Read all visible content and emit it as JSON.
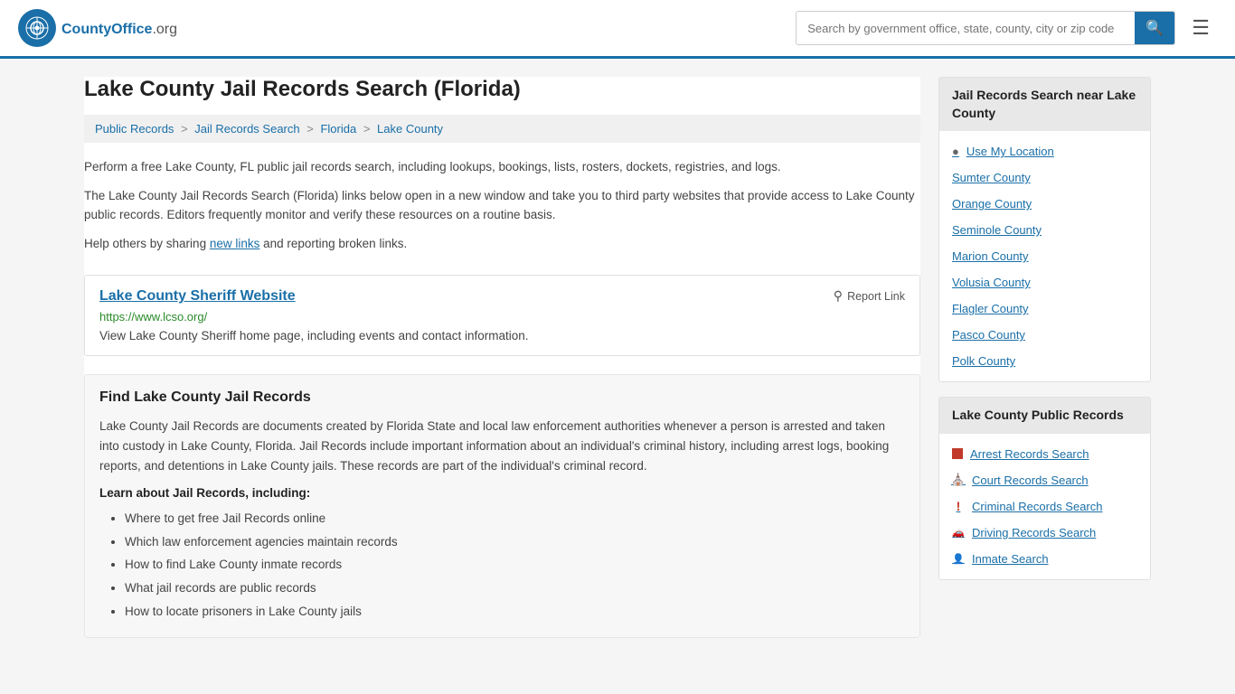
{
  "header": {
    "logo_text": "CountyOffice",
    "logo_suffix": ".org",
    "search_placeholder": "Search by government office, state, county, city or zip code"
  },
  "page": {
    "title": "Lake County Jail Records Search (Florida)",
    "breadcrumb": [
      {
        "label": "Public Records",
        "href": "#"
      },
      {
        "label": "Jail Records Search",
        "href": "#"
      },
      {
        "label": "Florida",
        "href": "#"
      },
      {
        "label": "Lake County",
        "href": "#"
      }
    ],
    "description1": "Perform a free Lake County, FL public jail records search, including lookups, bookings, lists, rosters, dockets, registries, and logs.",
    "description2": "The Lake County Jail Records Search (Florida) links below open in a new window and take you to third party websites that provide access to Lake County public records. Editors frequently monitor and verify these resources on a routine basis.",
    "description3_prefix": "Help others by sharing ",
    "description3_link": "new links",
    "description3_suffix": " and reporting broken links.",
    "link_card": {
      "title": "Lake County Sheriff Website",
      "report_label": "Report Link",
      "url": "https://www.lcso.org/",
      "description": "View Lake County Sheriff home page, including events and contact information."
    },
    "find_section": {
      "title": "Find Lake County Jail Records",
      "text": "Lake County Jail Records are documents created by Florida State and local law enforcement authorities whenever a person is arrested and taken into custody in Lake County, Florida. Jail Records include important information about an individual's criminal history, including arrest logs, booking reports, and detentions in Lake County jails. These records are part of the individual's criminal record.",
      "learn_title": "Learn about Jail Records, including:",
      "learn_items": [
        "Where to get free Jail Records online",
        "Which law enforcement agencies maintain records",
        "How to find Lake County inmate records",
        "What jail records are public records",
        "How to locate prisoners in Lake County jails"
      ]
    }
  },
  "sidebar": {
    "nearby_title": "Jail Records Search near Lake County",
    "use_location": "Use My Location",
    "nearby_counties": [
      "Sumter County",
      "Orange County",
      "Seminole County",
      "Marion County",
      "Volusia County",
      "Flagler County",
      "Pasco County",
      "Polk County"
    ],
    "public_records_title": "Lake County Public Records",
    "public_records_links": [
      {
        "label": "Arrest Records Search",
        "icon": "square"
      },
      {
        "label": "Court Records Search",
        "icon": "building"
      },
      {
        "label": "Criminal Records Search",
        "icon": "exclaim"
      },
      {
        "label": "Driving Records Search",
        "icon": "car"
      },
      {
        "label": "Inmate Search",
        "icon": "person"
      }
    ]
  }
}
